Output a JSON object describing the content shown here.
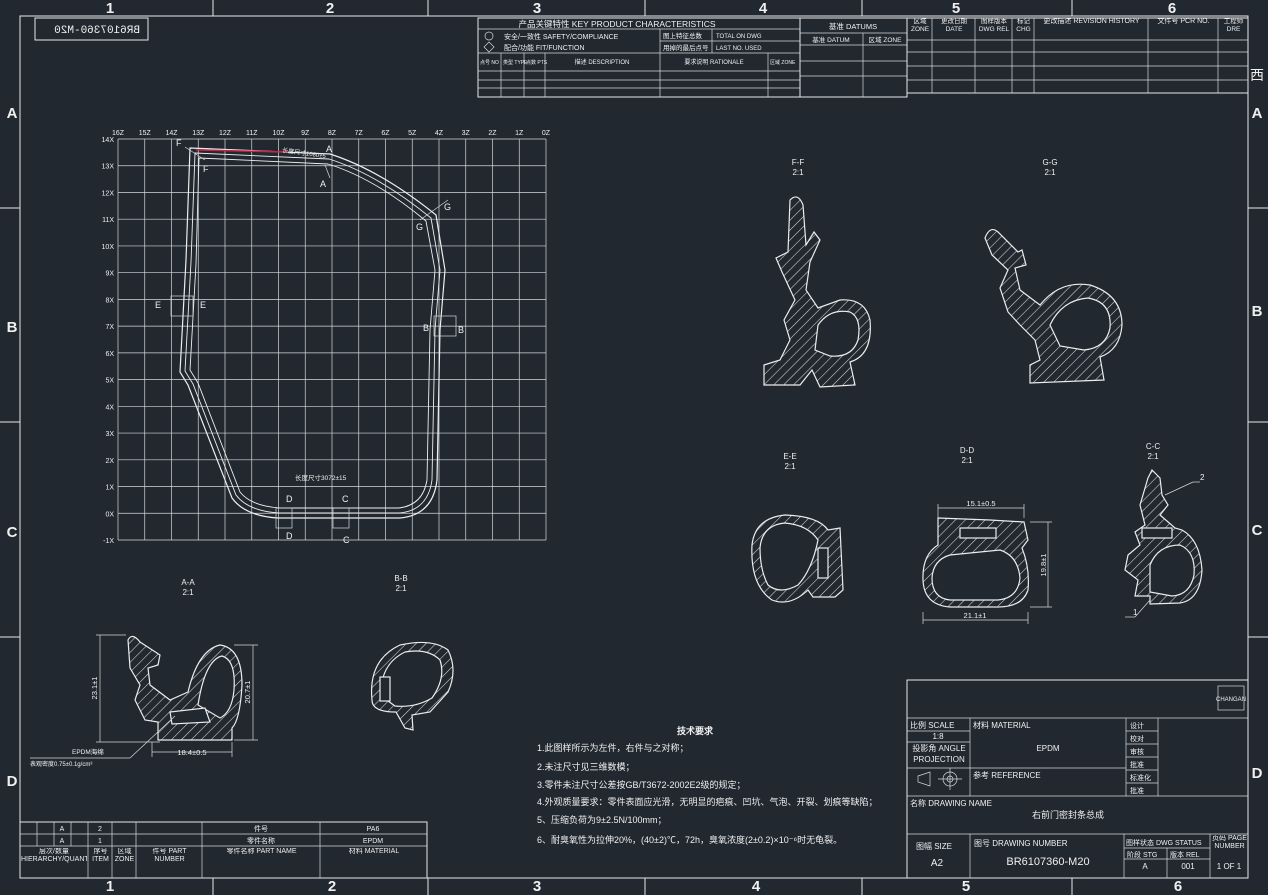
{
  "zones_cols": [
    "1",
    "2",
    "3",
    "4",
    "5",
    "6"
  ],
  "zones_rows": [
    "A",
    "B",
    "C",
    "D"
  ],
  "part_id_mirror": "BR6107360-M20",
  "kpc": {
    "title": "产品关键特性 KEY PRODUCT CHARACTERISTICS",
    "safety": "安全/一致性 SAFETY/COMPLIANCE",
    "fit": "配合/功能 FIT/FUNCTION",
    "total_cn": "图上特征总数",
    "total_en": "TOTAL ON DWG",
    "last_cn": "用掉的最后点号",
    "last_en": "LAST NO. USED",
    "h_no": "点号 NO",
    "h_type": "类型 TYPE",
    "h_pts": "点数 PTS",
    "h_desc": "描述 DESCRIPTION",
    "h_rat": "要求说明 RATIONALE",
    "h_zone": "区域 ZONE"
  },
  "datums": {
    "title": "基准 DATUMS",
    "datum": "基准 DATUM",
    "zone": "区域 ZONE"
  },
  "revision": {
    "zone": "区域 ZONE",
    "date": "更改日期 DATE",
    "dwg_rel": "图样版本 DWG REL",
    "chg": "标记 CHG",
    "history": "更改描述 REVISION HISTORY",
    "pcr": "文件号 PCR NO.",
    "dre": "工程师 DRE"
  },
  "grid": {
    "x_labels": [
      "16Z",
      "15Z",
      "14Z",
      "13Z",
      "12Z",
      "11Z",
      "10Z",
      "9Z",
      "8Z",
      "7Z",
      "6Z",
      "5Z",
      "4Z",
      "3Z",
      "2Z",
      "1Z",
      "0Z"
    ],
    "y_labels": [
      "14X",
      "13X",
      "12X",
      "11X",
      "10X",
      "9X",
      "8X",
      "7X",
      "6X",
      "5X",
      "4X",
      "3X",
      "2X",
      "1X",
      "0X",
      "-1X"
    ],
    "top_dim": "长度尺寸1080±5",
    "bottom_dim": "长度尺寸3072±15"
  },
  "sections": {
    "ff": {
      "name": "F-F",
      "scale": "2:1"
    },
    "gg": {
      "name": "G-G",
      "scale": "2:1"
    },
    "ee": {
      "name": "E-E",
      "scale": "2:1"
    },
    "dd": {
      "name": "D-D",
      "scale": "2:1",
      "w_top": "15.1±0.5",
      "w_bot": "21.1±1",
      "h": "19.8±1"
    },
    "cc": {
      "name": "C-C",
      "scale": "2:1",
      "n1": "1",
      "n2": "2"
    },
    "aa": {
      "name": "A-A",
      "scale": "2:1",
      "h1": "23.1±1",
      "h2": "20.7±1",
      "w": "18.4±0.5"
    },
    "bb": {
      "name": "B-B",
      "scale": "2:1"
    }
  },
  "epdm_note": "EPDM海绵",
  "density_note": "表观密度0.75±0.1g/cm³",
  "tech": {
    "title": "技术要求",
    "items": [
      "1.此图样所示为左件，右件与之对称；",
      "2.未注尺寸见三维数模；",
      "3.零件未注尺寸公差按GB/T3672-2002E2级的规定；",
      "4.外观质量要求：零件表面应光滑，无明显的疤痕、凹坑、气泡、开裂、划痕等缺陷；",
      "5、压缩负荷为9±2.5N/100mm；",
      "6、耐臭氧性为拉伸20%，(40±2)℃，72h，臭氧浓度(2±0.2)×10⁻⁶时无龟裂。"
    ]
  },
  "bom": {
    "r1": [
      "A",
      "2",
      "件号",
      "PA6"
    ],
    "r2": [
      "A",
      "1",
      "零件名称",
      "EPDM"
    ],
    "h_hier": "层次/数量 HIERARCHY/QUANTITY",
    "h_item": "序号 ITEM",
    "h_zone": "区域 ZONE",
    "h_part": "件号 PART NUMBER",
    "h_name": "零件名称 PART NAME",
    "h_mat": "材料 MATERIAL"
  },
  "title": {
    "logo": "CHANGAN",
    "scale_lbl": "比例 SCALE",
    "scale": "1:8",
    "material_lbl": "材料 MATERIAL",
    "material": "EPDM",
    "angle_lbl": "投影角 ANGLE PROJECTION",
    "reference_lbl": "参考 REFERENCE",
    "sign": [
      "设计",
      "校对",
      "审核",
      "批准",
      "标准化",
      "批准"
    ],
    "name_lbl": "名称 DRAWING NAME",
    "name": "右前门密封条总成",
    "size_lbl": "图幅 SIZE",
    "size": "A2",
    "num_lbl": "图号 DRAWING NUMBER",
    "num": "BR6107360-M20",
    "status_lbl": "图样状态 DWG STATUS",
    "stg_lbl": "阶段 STG",
    "stg": "A",
    "rel_lbl": "版本 REL",
    "rel": "001",
    "page_lbl": "页码 PAGE NUMBER",
    "page": "1 OF 1"
  },
  "west_glyph": "西"
}
